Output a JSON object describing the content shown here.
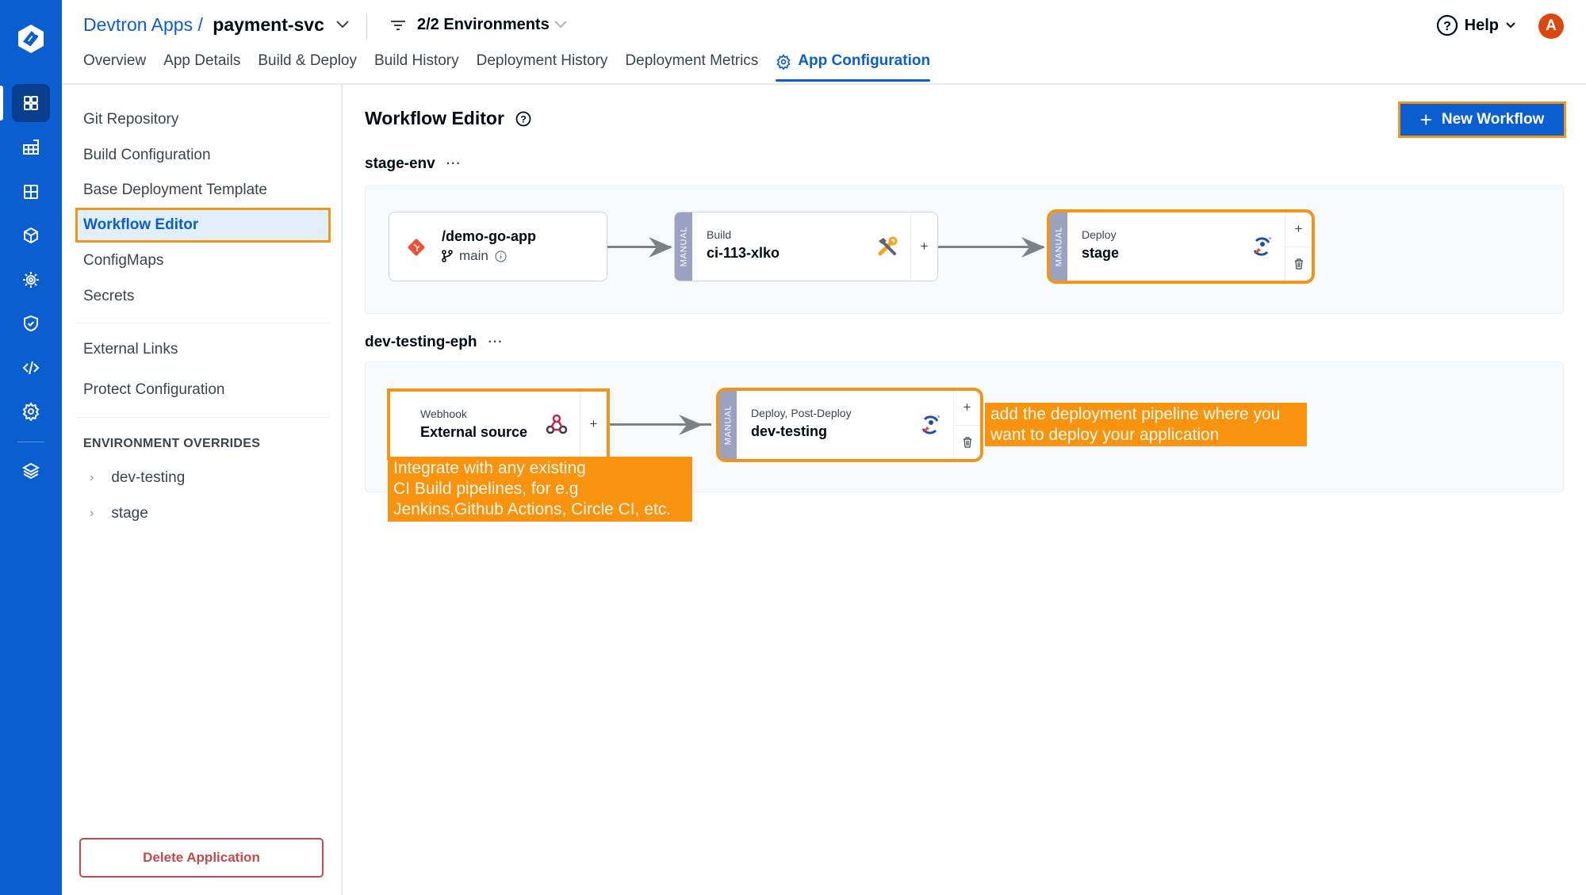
{
  "nav": {
    "logo": "devtron-logo",
    "items": [
      {
        "icon": "grid-icon",
        "active": true
      },
      {
        "icon": "table-grid-icon"
      },
      {
        "icon": "window-grid-icon"
      },
      {
        "icon": "cube-icon"
      },
      {
        "icon": "sun-gear-icon"
      },
      {
        "icon": "shield-check-icon"
      },
      {
        "icon": "code-icon"
      },
      {
        "icon": "settings-gear-icon"
      },
      {
        "icon": "stack-layers-icon"
      }
    ]
  },
  "header": {
    "breadcrumb_parent": "Devtron Apps",
    "breadcrumb_separator": "/",
    "app_name": "payment-svc",
    "env_filter": "2/2 Environments",
    "help_label": "Help",
    "avatar_initial": "A",
    "tabs": [
      {
        "label": "Overview"
      },
      {
        "label": "App Details"
      },
      {
        "label": "Build & Deploy"
      },
      {
        "label": "Build History"
      },
      {
        "label": "Deployment History"
      },
      {
        "label": "Deployment Metrics"
      },
      {
        "label": "App Configuration",
        "active": true
      }
    ]
  },
  "sidebar": {
    "items": [
      {
        "label": "Git Repository"
      },
      {
        "label": "Build Configuration"
      },
      {
        "label": "Base Deployment Template"
      },
      {
        "label": "Workflow Editor",
        "active": true
      },
      {
        "label": "ConfigMaps"
      },
      {
        "label": "Secrets"
      }
    ],
    "extra_items": [
      {
        "label": "External Links"
      },
      {
        "label": "Protect Configuration"
      }
    ],
    "overrides_title": "ENVIRONMENT OVERRIDES",
    "overrides": [
      {
        "label": "dev-testing"
      },
      {
        "label": "stage"
      }
    ],
    "delete_label": "Delete Application"
  },
  "main": {
    "title": "Workflow Editor",
    "new_workflow_label": "New Workflow",
    "workflows": [
      {
        "name": "stage-env",
        "git": {
          "repo": "/demo-go-app",
          "branch": "main"
        },
        "build": {
          "trigger": "MANUAL",
          "type": "Build",
          "name": "ci-113-xlko"
        },
        "deploy": {
          "trigger": "MANUAL",
          "type": "Deploy",
          "name": "stage"
        }
      },
      {
        "name": "dev-testing-eph",
        "source": {
          "type": "Webhook",
          "name": "External source"
        },
        "deploy": {
          "trigger": "MANUAL",
          "type": "Deploy, Post-Deploy",
          "name": "dev-testing"
        }
      }
    ],
    "callouts": {
      "webhook": [
        "Integrate with any existing",
        "CI Build pipelines, for e.g",
        "Jenkins,Github Actions, Circle CI, etc."
      ],
      "deploy": [
        "add the deployment pipeline where you",
        "want to deploy your application"
      ]
    }
  },
  "colors": {
    "brand": "#0b5ed0",
    "highlight": "#f0951a",
    "callout": "#f7930f",
    "manual_tag": "#9da1c1",
    "danger": "#c5494c"
  }
}
